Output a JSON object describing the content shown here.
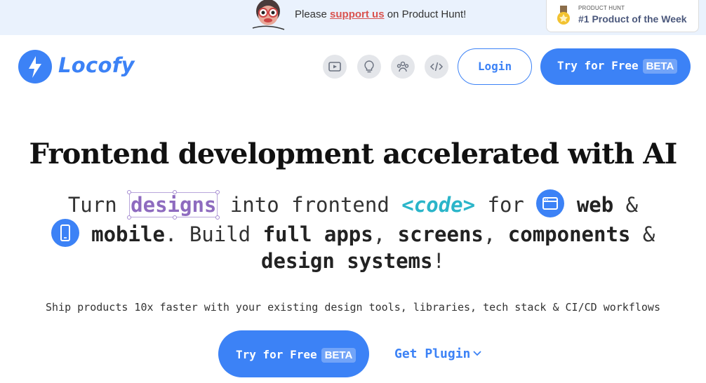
{
  "announcement": {
    "prefix": "Please ",
    "link": "support us",
    "suffix": " on Product Hunt!",
    "badge_small": "PRODUCT HUNT",
    "badge_big": "#1 Product of the Week"
  },
  "header": {
    "brand": "Locofy",
    "nav_icons": [
      "video-icon",
      "lightbulb-icon",
      "community-icon",
      "code-icon"
    ],
    "login": "Login",
    "try_label": "Try for Free",
    "beta": "BETA"
  },
  "hero": {
    "title": "Frontend development accelerated with AI",
    "l1_a": "Turn ",
    "designs": "designs",
    "l1_b": " into frontend ",
    "code": "<code>",
    "l1_c": " for ",
    "web": "web",
    "l1_d": " &",
    "mobile": "mobile",
    "l2_a": ". Build ",
    "full_apps": "full apps",
    "l2_b": ", ",
    "screens": "screens",
    "l2_c": ", ",
    "components": "components",
    "l2_d": " &",
    "design_systems": "design systems",
    "l3_end": "!",
    "tagline": "Ship products 10x faster with your existing design tools, libraries, tech stack & CI/CD workflows",
    "cta_label": "Try for Free",
    "cta_beta": "BETA",
    "plugin": "Get Plugin"
  },
  "colors": {
    "accent": "#3c82f6",
    "designs": "#8e6bbf",
    "code": "#2bb5c9",
    "banner": "#eaf2fd"
  }
}
